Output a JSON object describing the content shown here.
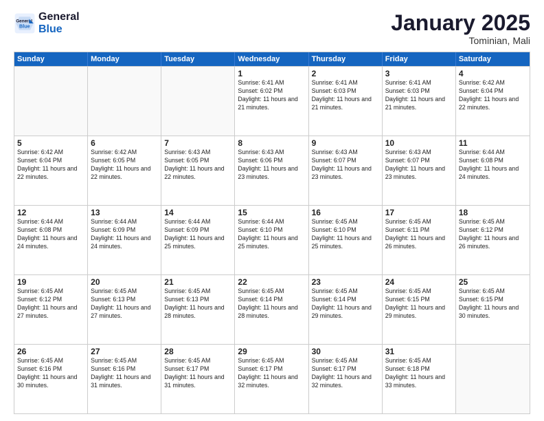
{
  "logo": {
    "line1": "General",
    "line2": "Blue"
  },
  "calendar": {
    "title": "January 2025",
    "subtitle": "Tominian, Mali",
    "days": [
      "Sunday",
      "Monday",
      "Tuesday",
      "Wednesday",
      "Thursday",
      "Friday",
      "Saturday"
    ],
    "weeks": [
      [
        {
          "day": "",
          "empty": true
        },
        {
          "day": "",
          "empty": true
        },
        {
          "day": "",
          "empty": true
        },
        {
          "day": "1",
          "sunrise": "Sunrise: 6:41 AM",
          "sunset": "Sunset: 6:02 PM",
          "daylight": "Daylight: 11 hours and 21 minutes."
        },
        {
          "day": "2",
          "sunrise": "Sunrise: 6:41 AM",
          "sunset": "Sunset: 6:03 PM",
          "daylight": "Daylight: 11 hours and 21 minutes."
        },
        {
          "day": "3",
          "sunrise": "Sunrise: 6:41 AM",
          "sunset": "Sunset: 6:03 PM",
          "daylight": "Daylight: 11 hours and 21 minutes."
        },
        {
          "day": "4",
          "sunrise": "Sunrise: 6:42 AM",
          "sunset": "Sunset: 6:04 PM",
          "daylight": "Daylight: 11 hours and 22 minutes."
        }
      ],
      [
        {
          "day": "5",
          "sunrise": "Sunrise: 6:42 AM",
          "sunset": "Sunset: 6:04 PM",
          "daylight": "Daylight: 11 hours and 22 minutes."
        },
        {
          "day": "6",
          "sunrise": "Sunrise: 6:42 AM",
          "sunset": "Sunset: 6:05 PM",
          "daylight": "Daylight: 11 hours and 22 minutes."
        },
        {
          "day": "7",
          "sunrise": "Sunrise: 6:43 AM",
          "sunset": "Sunset: 6:05 PM",
          "daylight": "Daylight: 11 hours and 22 minutes."
        },
        {
          "day": "8",
          "sunrise": "Sunrise: 6:43 AM",
          "sunset": "Sunset: 6:06 PM",
          "daylight": "Daylight: 11 hours and 23 minutes."
        },
        {
          "day": "9",
          "sunrise": "Sunrise: 6:43 AM",
          "sunset": "Sunset: 6:07 PM",
          "daylight": "Daylight: 11 hours and 23 minutes."
        },
        {
          "day": "10",
          "sunrise": "Sunrise: 6:43 AM",
          "sunset": "Sunset: 6:07 PM",
          "daylight": "Daylight: 11 hours and 23 minutes."
        },
        {
          "day": "11",
          "sunrise": "Sunrise: 6:44 AM",
          "sunset": "Sunset: 6:08 PM",
          "daylight": "Daylight: 11 hours and 24 minutes."
        }
      ],
      [
        {
          "day": "12",
          "sunrise": "Sunrise: 6:44 AM",
          "sunset": "Sunset: 6:08 PM",
          "daylight": "Daylight: 11 hours and 24 minutes."
        },
        {
          "day": "13",
          "sunrise": "Sunrise: 6:44 AM",
          "sunset": "Sunset: 6:09 PM",
          "daylight": "Daylight: 11 hours and 24 minutes."
        },
        {
          "day": "14",
          "sunrise": "Sunrise: 6:44 AM",
          "sunset": "Sunset: 6:09 PM",
          "daylight": "Daylight: 11 hours and 25 minutes."
        },
        {
          "day": "15",
          "sunrise": "Sunrise: 6:44 AM",
          "sunset": "Sunset: 6:10 PM",
          "daylight": "Daylight: 11 hours and 25 minutes."
        },
        {
          "day": "16",
          "sunrise": "Sunrise: 6:45 AM",
          "sunset": "Sunset: 6:10 PM",
          "daylight": "Daylight: 11 hours and 25 minutes."
        },
        {
          "day": "17",
          "sunrise": "Sunrise: 6:45 AM",
          "sunset": "Sunset: 6:11 PM",
          "daylight": "Daylight: 11 hours and 26 minutes."
        },
        {
          "day": "18",
          "sunrise": "Sunrise: 6:45 AM",
          "sunset": "Sunset: 6:12 PM",
          "daylight": "Daylight: 11 hours and 26 minutes."
        }
      ],
      [
        {
          "day": "19",
          "sunrise": "Sunrise: 6:45 AM",
          "sunset": "Sunset: 6:12 PM",
          "daylight": "Daylight: 11 hours and 27 minutes."
        },
        {
          "day": "20",
          "sunrise": "Sunrise: 6:45 AM",
          "sunset": "Sunset: 6:13 PM",
          "daylight": "Daylight: 11 hours and 27 minutes."
        },
        {
          "day": "21",
          "sunrise": "Sunrise: 6:45 AM",
          "sunset": "Sunset: 6:13 PM",
          "daylight": "Daylight: 11 hours and 28 minutes."
        },
        {
          "day": "22",
          "sunrise": "Sunrise: 6:45 AM",
          "sunset": "Sunset: 6:14 PM",
          "daylight": "Daylight: 11 hours and 28 minutes."
        },
        {
          "day": "23",
          "sunrise": "Sunrise: 6:45 AM",
          "sunset": "Sunset: 6:14 PM",
          "daylight": "Daylight: 11 hours and 29 minutes."
        },
        {
          "day": "24",
          "sunrise": "Sunrise: 6:45 AM",
          "sunset": "Sunset: 6:15 PM",
          "daylight": "Daylight: 11 hours and 29 minutes."
        },
        {
          "day": "25",
          "sunrise": "Sunrise: 6:45 AM",
          "sunset": "Sunset: 6:15 PM",
          "daylight": "Daylight: 11 hours and 30 minutes."
        }
      ],
      [
        {
          "day": "26",
          "sunrise": "Sunrise: 6:45 AM",
          "sunset": "Sunset: 6:16 PM",
          "daylight": "Daylight: 11 hours and 30 minutes."
        },
        {
          "day": "27",
          "sunrise": "Sunrise: 6:45 AM",
          "sunset": "Sunset: 6:16 PM",
          "daylight": "Daylight: 11 hours and 31 minutes."
        },
        {
          "day": "28",
          "sunrise": "Sunrise: 6:45 AM",
          "sunset": "Sunset: 6:17 PM",
          "daylight": "Daylight: 11 hours and 31 minutes."
        },
        {
          "day": "29",
          "sunrise": "Sunrise: 6:45 AM",
          "sunset": "Sunset: 6:17 PM",
          "daylight": "Daylight: 11 hours and 32 minutes."
        },
        {
          "day": "30",
          "sunrise": "Sunrise: 6:45 AM",
          "sunset": "Sunset: 6:17 PM",
          "daylight": "Daylight: 11 hours and 32 minutes."
        },
        {
          "day": "31",
          "sunrise": "Sunrise: 6:45 AM",
          "sunset": "Sunset: 6:18 PM",
          "daylight": "Daylight: 11 hours and 33 minutes."
        },
        {
          "day": "",
          "empty": true
        }
      ]
    ]
  }
}
